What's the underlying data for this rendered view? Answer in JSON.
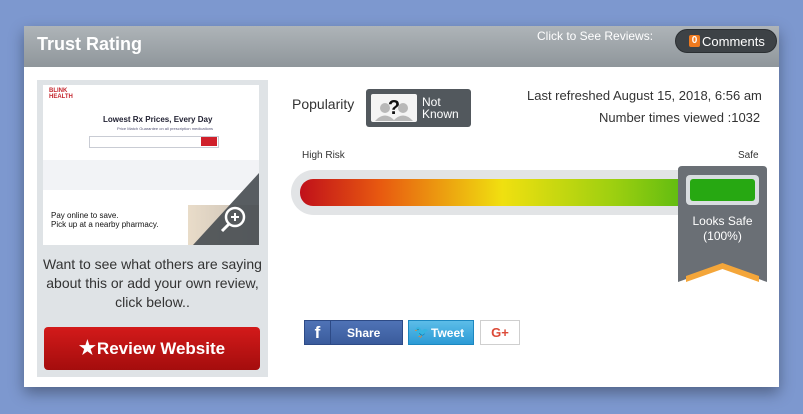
{
  "header": {
    "title": "Trust Rating",
    "reviews_hint": "Click to See Reviews:",
    "comments_count": "0",
    "comments_label": "Comments"
  },
  "thumbnail": {
    "logo_text": "BLINK HEALTH",
    "headline": "Lowest Rx Prices, Every Day",
    "subtext": "Price Match Guarantee on all prescription medications",
    "promo_line1": "Pay online to save.",
    "promo_line2": "Pick up at a nearby pharmacy.",
    "zoom_icon": "zoom-in-icon"
  },
  "left_panel": {
    "prompt": "Want to see what others are saying about this or add your own review, click below..",
    "review_button_star": "★",
    "review_button_label": "Review Website"
  },
  "popularity": {
    "label": "Popularity",
    "value_line1": "Not",
    "value_line2": "Known",
    "icon": "unknown-person-icon"
  },
  "stats": {
    "refreshed": "Last refreshed August 15, 2018, 6:56 am",
    "views": "Number times viewed :1032"
  },
  "meter": {
    "low_label": "High Risk",
    "high_label": "Safe",
    "status_line1": "Looks Safe",
    "status_line2": "(100%)",
    "level_percent": 100,
    "colors": [
      "#c0101a",
      "#e85a10",
      "#f0e010",
      "#9ccf10",
      "#24a812"
    ]
  },
  "share": {
    "facebook_label": "Share",
    "twitter_label": "Tweet",
    "google_label": "G+"
  }
}
